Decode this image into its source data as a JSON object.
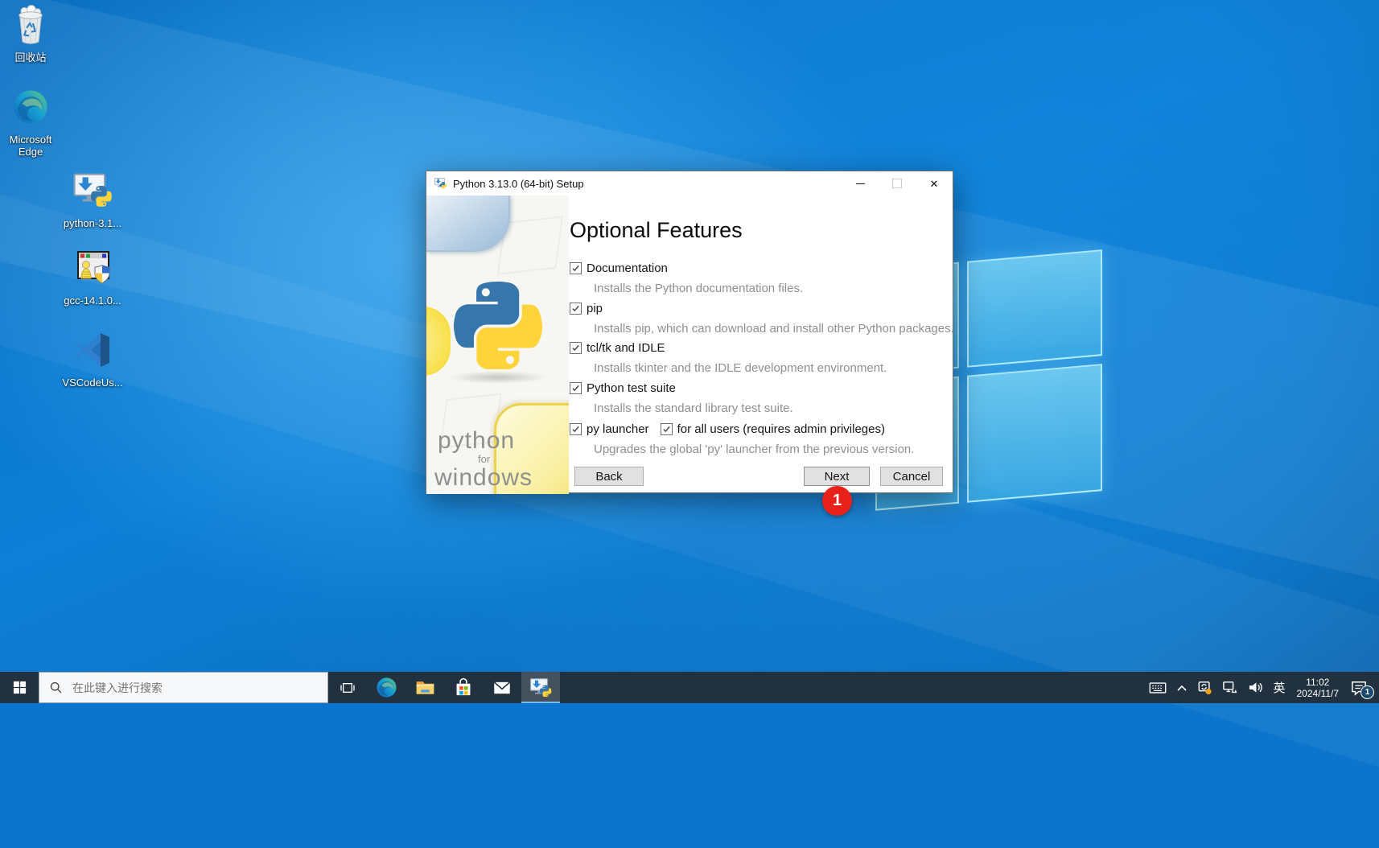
{
  "desktop_icons": [
    {
      "id": "recycle-bin",
      "label": "回收站"
    },
    {
      "id": "microsoft-edge",
      "label": "Microsoft Edge"
    },
    {
      "id": "python-installer-file",
      "label": "python-3.1..."
    },
    {
      "id": "gcc-installer-file",
      "label": "gcc-14.1.0..."
    },
    {
      "id": "vscode-installer-file",
      "label": "VSCodeUs..."
    }
  ],
  "installer": {
    "window_title": "Python 3.13.0 (64-bit) Setup",
    "heading": "Optional Features",
    "features": [
      {
        "label": "Documentation",
        "checked": true,
        "desc": "Installs the Python documentation files."
      },
      {
        "label": "pip",
        "checked": true,
        "desc": "Installs pip, which can download and install other Python packages."
      },
      {
        "label": "tcl/tk and IDLE",
        "checked": true,
        "desc": "Installs tkinter and the IDLE development environment."
      },
      {
        "label": "Python test suite",
        "checked": true,
        "desc": "Installs the standard library test suite."
      },
      {
        "label": "py launcher",
        "checked": true,
        "label2": "for all users (requires admin privileges)",
        "checked2": true,
        "desc": "Upgrades the global 'py' launcher from the previous version."
      }
    ],
    "buttons": {
      "back": "Back",
      "next": "Next",
      "cancel": "Cancel"
    },
    "sidebar_text": {
      "line1": "python",
      "line2": "for",
      "line3": "windows"
    },
    "annotation_badge": "1"
  },
  "taskbar": {
    "search_placeholder": "在此键入进行搜索",
    "tray": {
      "ime_label": "英",
      "time": "11:02",
      "date": "2024/11/7",
      "notification_count": "1"
    }
  },
  "colors": {
    "desktop_blue": "#0d7fd6",
    "taskbar_bg": "#22313f",
    "active_underline": "#76b9ed",
    "annotation_red": "#e8221b",
    "python_blue": "#3776ab",
    "python_yellow": "#ffd43b"
  }
}
